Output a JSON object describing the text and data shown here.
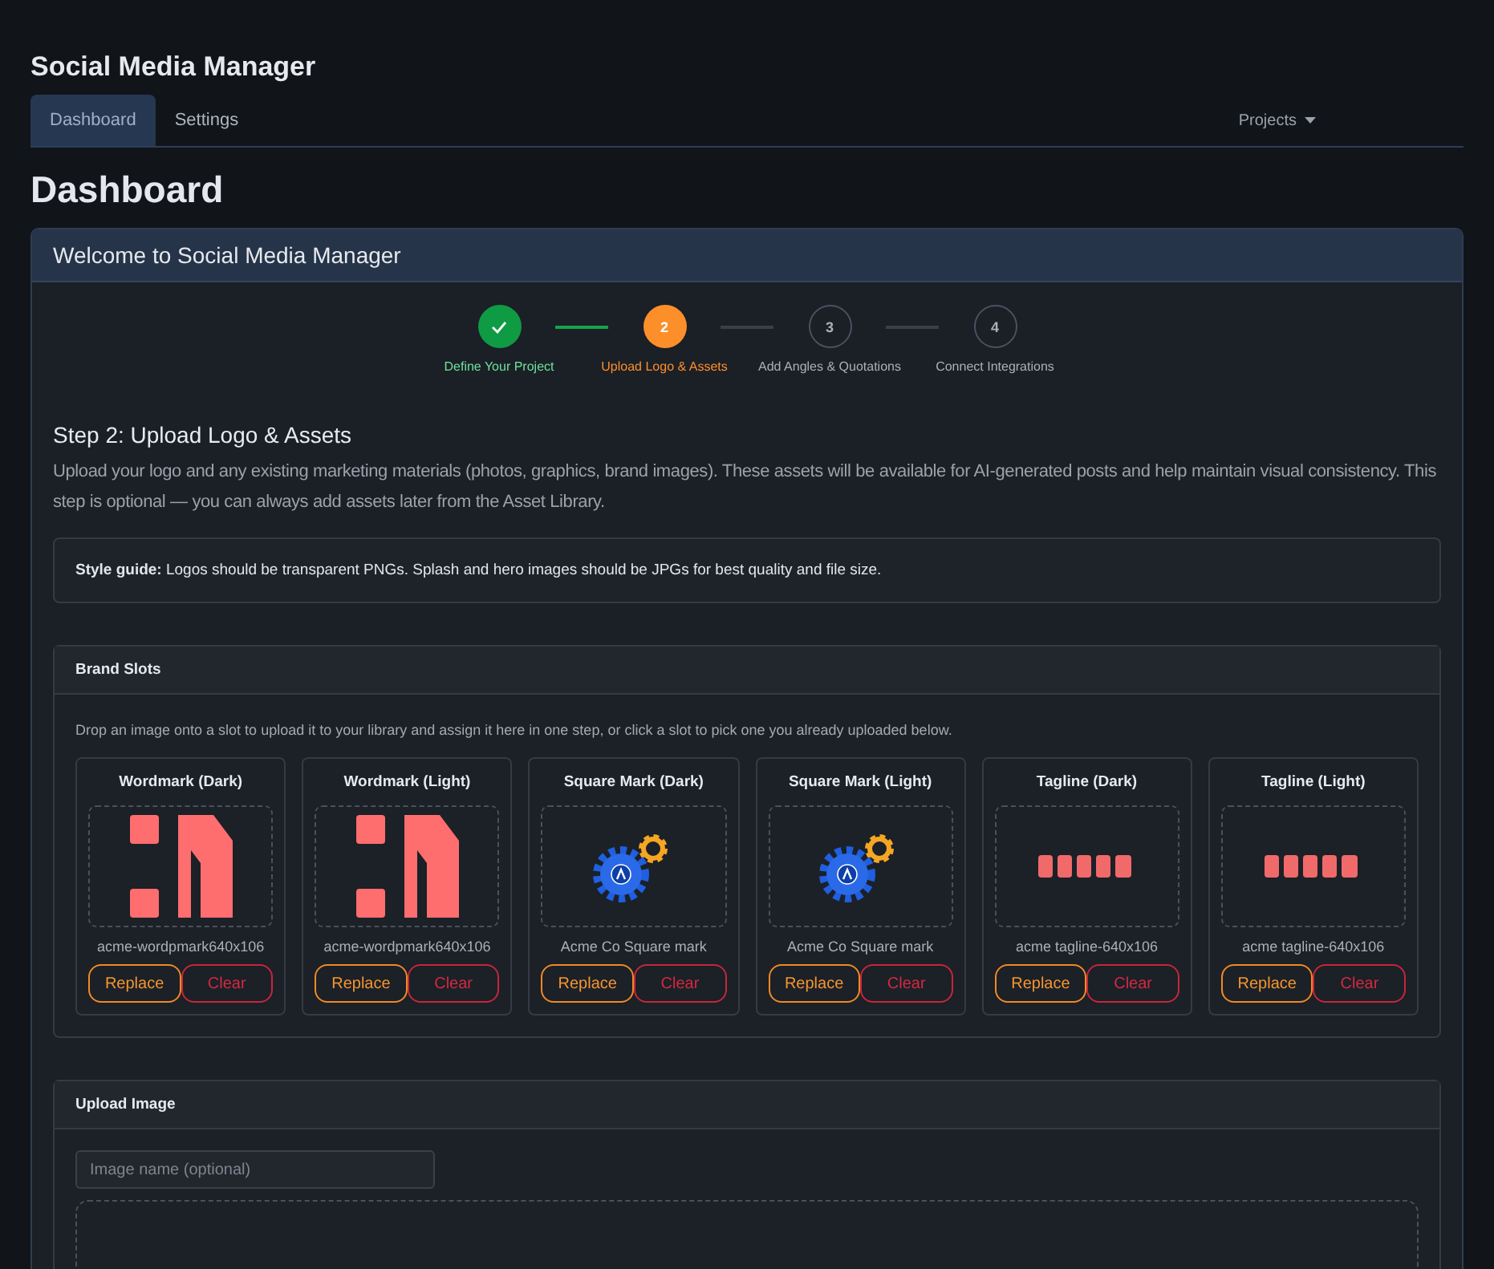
{
  "app_title": "Social Media Manager",
  "tabs": [
    {
      "label": "Dashboard",
      "selected": true
    },
    {
      "label": "Settings",
      "selected": false
    }
  ],
  "projects_menu": {
    "label": "Projects"
  },
  "page_title": "Dashboard",
  "card": {
    "title": "Welcome to Social Media Manager"
  },
  "steps": [
    {
      "label": "Define Your Project",
      "kind": "done"
    },
    {
      "label": "Upload Logo & Assets",
      "number": "2",
      "kind": "active"
    },
    {
      "label": "Add Angles & Quotations",
      "number": "3",
      "kind": "pending"
    },
    {
      "label": "Connect Integrations",
      "number": "4",
      "kind": "pending"
    }
  ],
  "step_heading": "Step 2: Upload Logo & Assets",
  "step_description": "Upload your logo and any existing marketing materials (photos, graphics, brand images). These assets will be available for AI-generated posts and help maintain visual consistency. This step is optional — you can always add assets later from the Asset Library.",
  "style_guide": "**Style guide:** Logos should be transparent PNGs. Splash and hero images should be JPGs for best quality and file size.",
  "brand_slots": {
    "title": "Brand Slots",
    "hint": "Drop an image onto a slot to upload it to your library and assign it here in one step, or click a slot to pick one you already uploaded below.",
    "slots": [
      {
        "title": "Wordmark (Dark)",
        "kind": "wordmark",
        "filename": "acme-wordpmark640x106",
        "replace": "Replace",
        "clear": "Clear"
      },
      {
        "title": "Wordmark (Light)",
        "kind": "wordmark",
        "filename": "acme-wordpmark640x106",
        "replace": "Replace",
        "clear": "Clear"
      },
      {
        "title": "Square Mark (Dark)",
        "kind": "gears",
        "filename": "Acme Co Square mark",
        "replace": "Replace",
        "clear": "Clear"
      },
      {
        "title": "Square Mark (Light)",
        "kind": "gears",
        "filename": "Acme Co Square mark",
        "replace": "Replace",
        "clear": "Clear"
      },
      {
        "title": "Tagline (Dark)",
        "kind": "tagline",
        "filename": "acme tagline-640x106",
        "replace": "Replace",
        "clear": "Clear"
      },
      {
        "title": "Tagline (Light)",
        "kind": "tagline",
        "filename": "acme tagline-640x106",
        "replace": "Replace",
        "clear": "Clear"
      }
    ]
  },
  "upload_image": {
    "title": "Upload Image",
    "name_field": {
      "placeholder": "Image name (optional)"
    }
  }
}
